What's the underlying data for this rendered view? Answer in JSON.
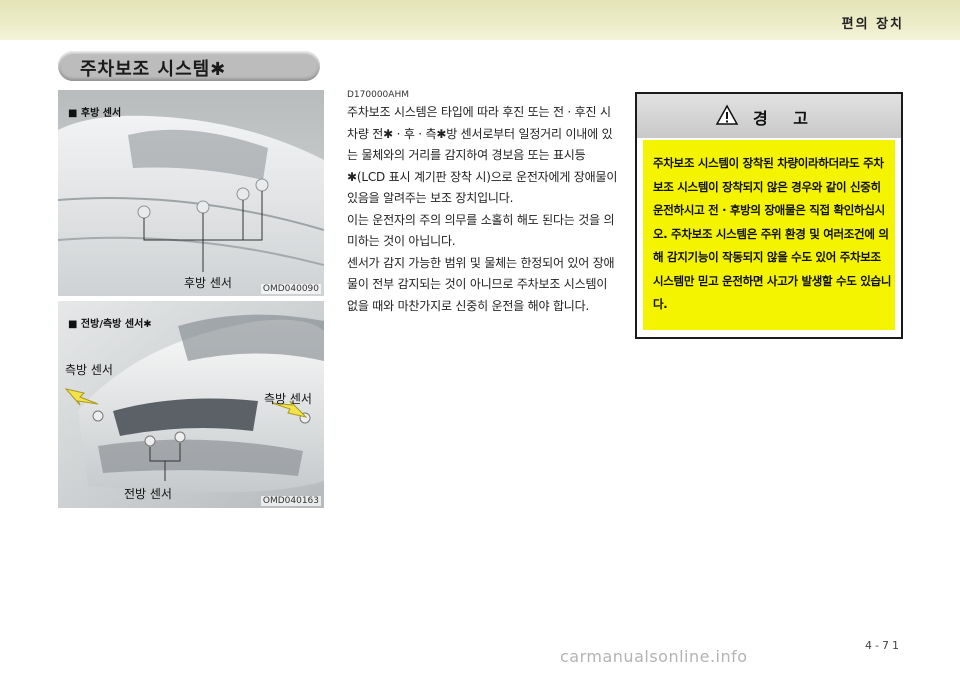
{
  "header": {
    "title": "편의 장치"
  },
  "section": {
    "title": "주차보조 시스템✱"
  },
  "figure_rear": {
    "tag": "■ 후방 센서",
    "label": "후방 센서",
    "code": "OMD040090"
  },
  "figure_front": {
    "tag": "■ 전방/측방 센서✱",
    "label_side_left": "측방 센서",
    "label_side_right": "측방 센서",
    "label_front": "전방 센서",
    "code": "OMD040163"
  },
  "body": {
    "code": "D170000AHM",
    "para1": "주차보조 시스템은 타입에 따라 후진 또는 전 · 후진 시 차량 전✱ · 후 · 측✱방 센서로부터 일정거리 이내에 있는 물체와의 거리를 감지하여 경보음 또는 표시등✱(LCD 표시 계기판 장착 시)으로 운전자에게 장애물이 있음을 알려주는 보조 장치입니다.",
    "para2": "이는 운전자의 주의 의무를 소홀히 해도 된다는 것을 의미하는 것이 아닙니다.",
    "para3": "센서가 감지 가능한 범위 및 물체는 한정되어 있어 장애물이 전부 감지되는 것이 아니므로 주차보조 시스템이 없을 때와 마찬가지로 신중히 운전을 해야 합니다."
  },
  "warning": {
    "icon": "warning-triangle-icon",
    "title": "경 고",
    "text": "주차보조 시스템이 장착된 차량이라하더라도 주차보조 시스템이 장착되지 않은 경우와 같이 신중히 운전하시고 전 · 후방의 장애물은 직접 확인하십시오. 주차보조 시스템은 주위 환경 및 여러조건에 의해 감지기능이 작동되지 않을 수도 있어 주차보조 시스템만 믿고 운전하면 사고가 발생할 수도 있습니다.",
    "box_color": "#f4f400"
  },
  "footer": {
    "page": "4-71",
    "watermark": "carmanualsonline.info"
  }
}
